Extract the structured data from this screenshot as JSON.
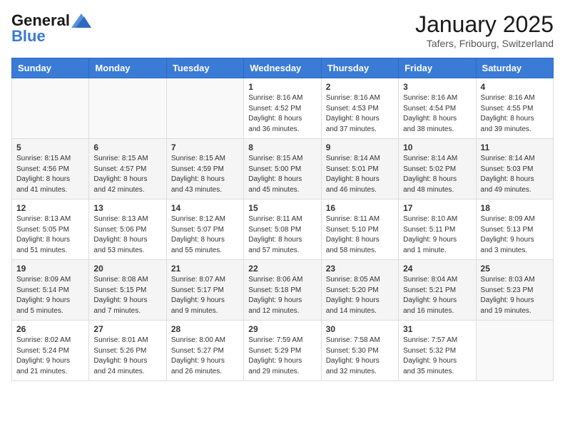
{
  "header": {
    "logo_general": "General",
    "logo_blue": "Blue",
    "month_title": "January 2025",
    "location": "Tafers, Fribourg, Switzerland"
  },
  "days_of_week": [
    "Sunday",
    "Monday",
    "Tuesday",
    "Wednesday",
    "Thursday",
    "Friday",
    "Saturday"
  ],
  "weeks": [
    [
      {
        "day": "",
        "info": ""
      },
      {
        "day": "",
        "info": ""
      },
      {
        "day": "",
        "info": ""
      },
      {
        "day": "1",
        "info": "Sunrise: 8:16 AM\nSunset: 4:52 PM\nDaylight: 8 hours\nand 36 minutes."
      },
      {
        "day": "2",
        "info": "Sunrise: 8:16 AM\nSunset: 4:53 PM\nDaylight: 8 hours\nand 37 minutes."
      },
      {
        "day": "3",
        "info": "Sunrise: 8:16 AM\nSunset: 4:54 PM\nDaylight: 8 hours\nand 38 minutes."
      },
      {
        "day": "4",
        "info": "Sunrise: 8:16 AM\nSunset: 4:55 PM\nDaylight: 8 hours\nand 39 minutes."
      }
    ],
    [
      {
        "day": "5",
        "info": "Sunrise: 8:15 AM\nSunset: 4:56 PM\nDaylight: 8 hours\nand 41 minutes."
      },
      {
        "day": "6",
        "info": "Sunrise: 8:15 AM\nSunset: 4:57 PM\nDaylight: 8 hours\nand 42 minutes."
      },
      {
        "day": "7",
        "info": "Sunrise: 8:15 AM\nSunset: 4:59 PM\nDaylight: 8 hours\nand 43 minutes."
      },
      {
        "day": "8",
        "info": "Sunrise: 8:15 AM\nSunset: 5:00 PM\nDaylight: 8 hours\nand 45 minutes."
      },
      {
        "day": "9",
        "info": "Sunrise: 8:14 AM\nSunset: 5:01 PM\nDaylight: 8 hours\nand 46 minutes."
      },
      {
        "day": "10",
        "info": "Sunrise: 8:14 AM\nSunset: 5:02 PM\nDaylight: 8 hours\nand 48 minutes."
      },
      {
        "day": "11",
        "info": "Sunrise: 8:14 AM\nSunset: 5:03 PM\nDaylight: 8 hours\nand 49 minutes."
      }
    ],
    [
      {
        "day": "12",
        "info": "Sunrise: 8:13 AM\nSunset: 5:05 PM\nDaylight: 8 hours\nand 51 minutes."
      },
      {
        "day": "13",
        "info": "Sunrise: 8:13 AM\nSunset: 5:06 PM\nDaylight: 8 hours\nand 53 minutes."
      },
      {
        "day": "14",
        "info": "Sunrise: 8:12 AM\nSunset: 5:07 PM\nDaylight: 8 hours\nand 55 minutes."
      },
      {
        "day": "15",
        "info": "Sunrise: 8:11 AM\nSunset: 5:08 PM\nDaylight: 8 hours\nand 57 minutes."
      },
      {
        "day": "16",
        "info": "Sunrise: 8:11 AM\nSunset: 5:10 PM\nDaylight: 8 hours\nand 58 minutes."
      },
      {
        "day": "17",
        "info": "Sunrise: 8:10 AM\nSunset: 5:11 PM\nDaylight: 9 hours\nand 1 minute."
      },
      {
        "day": "18",
        "info": "Sunrise: 8:09 AM\nSunset: 5:13 PM\nDaylight: 9 hours\nand 3 minutes."
      }
    ],
    [
      {
        "day": "19",
        "info": "Sunrise: 8:09 AM\nSunset: 5:14 PM\nDaylight: 9 hours\nand 5 minutes."
      },
      {
        "day": "20",
        "info": "Sunrise: 8:08 AM\nSunset: 5:15 PM\nDaylight: 9 hours\nand 7 minutes."
      },
      {
        "day": "21",
        "info": "Sunrise: 8:07 AM\nSunset: 5:17 PM\nDaylight: 9 hours\nand 9 minutes."
      },
      {
        "day": "22",
        "info": "Sunrise: 8:06 AM\nSunset: 5:18 PM\nDaylight: 9 hours\nand 12 minutes."
      },
      {
        "day": "23",
        "info": "Sunrise: 8:05 AM\nSunset: 5:20 PM\nDaylight: 9 hours\nand 14 minutes."
      },
      {
        "day": "24",
        "info": "Sunrise: 8:04 AM\nSunset: 5:21 PM\nDaylight: 9 hours\nand 16 minutes."
      },
      {
        "day": "25",
        "info": "Sunrise: 8:03 AM\nSunset: 5:23 PM\nDaylight: 9 hours\nand 19 minutes."
      }
    ],
    [
      {
        "day": "26",
        "info": "Sunrise: 8:02 AM\nSunset: 5:24 PM\nDaylight: 9 hours\nand 21 minutes."
      },
      {
        "day": "27",
        "info": "Sunrise: 8:01 AM\nSunset: 5:26 PM\nDaylight: 9 hours\nand 24 minutes."
      },
      {
        "day": "28",
        "info": "Sunrise: 8:00 AM\nSunset: 5:27 PM\nDaylight: 9 hours\nand 26 minutes."
      },
      {
        "day": "29",
        "info": "Sunrise: 7:59 AM\nSunset: 5:29 PM\nDaylight: 9 hours\nand 29 minutes."
      },
      {
        "day": "30",
        "info": "Sunrise: 7:58 AM\nSunset: 5:30 PM\nDaylight: 9 hours\nand 32 minutes."
      },
      {
        "day": "31",
        "info": "Sunrise: 7:57 AM\nSunset: 5:32 PM\nDaylight: 9 hours\nand 35 minutes."
      },
      {
        "day": "",
        "info": ""
      }
    ]
  ]
}
